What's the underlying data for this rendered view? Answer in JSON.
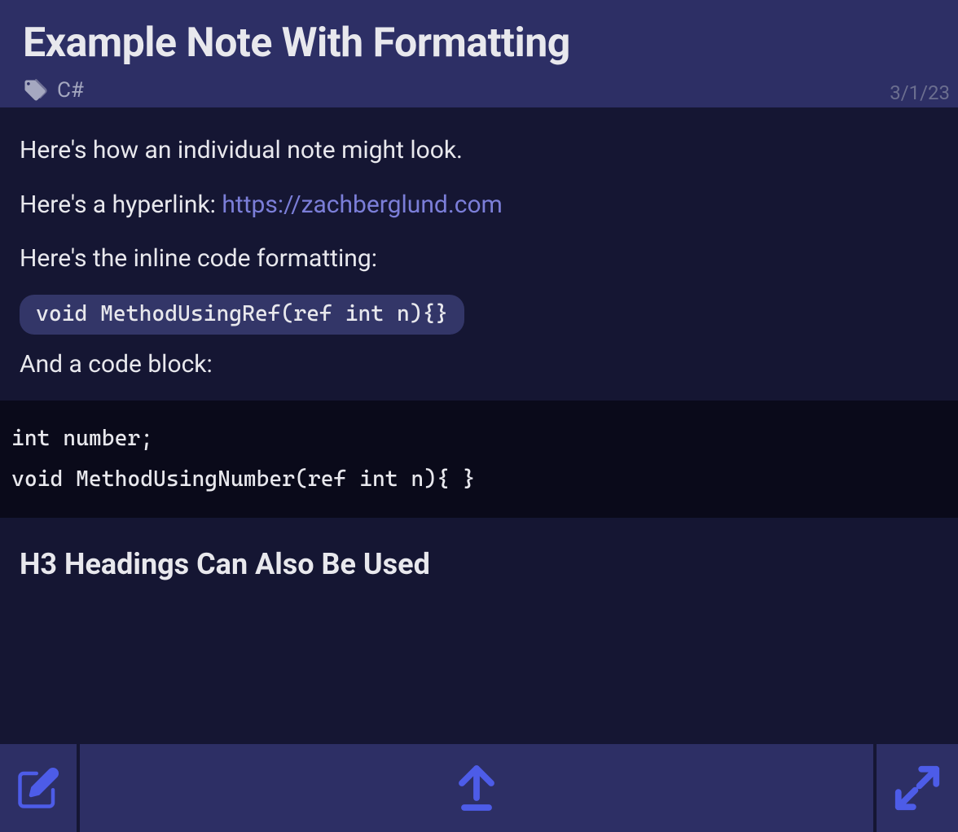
{
  "header": {
    "title": "Example Note With Formatting",
    "tag": "C#",
    "date": "3/1/23"
  },
  "content": {
    "p1": "Here's how an individual note might look.",
    "p2_prefix": "Here's a hyperlink: ",
    "link_text": "https://zachberglund.com",
    "p3": "Here's the inline code formatting:",
    "inline_code": "void MethodUsingRef(ref int n){}",
    "p4": "And a code block:",
    "code_block": "int number;\nvoid MethodUsingNumber(ref int n){ }",
    "h3": "H3 Headings Can Also Be Used"
  },
  "toolbar": {
    "edit_label": "Edit",
    "upload_label": "Upload",
    "expand_label": "Expand"
  }
}
